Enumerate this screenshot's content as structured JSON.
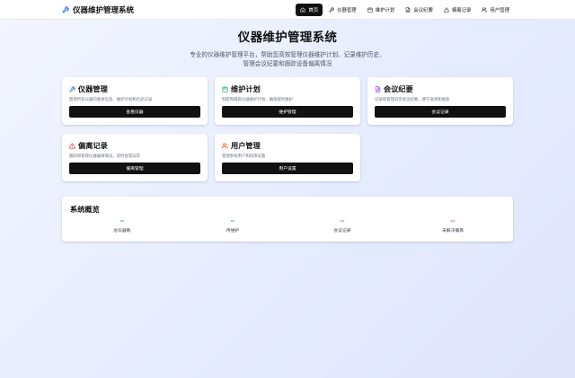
{
  "brand": {
    "title": "仪器维护管理系统",
    "icon": "wrench-icon"
  },
  "nav": [
    {
      "label": "首页",
      "icon": "home-icon",
      "active": true
    },
    {
      "label": "仪器管理",
      "icon": "wrench-icon"
    },
    {
      "label": "维护计划",
      "icon": "calendar-icon"
    },
    {
      "label": "会议纪要",
      "icon": "document-icon"
    },
    {
      "label": "偏离记录",
      "icon": "warning-icon"
    },
    {
      "label": "用户管理",
      "icon": "users-icon"
    }
  ],
  "hero": {
    "title": "仪器维护管理系统",
    "subtitle_line1": "专业的仪器维护管理平台，帮助您高效管理仪器维护计划、记录维护历史、",
    "subtitle_line2": "管理会议纪要和跟踪设备偏离情况"
  },
  "cards": {
    "instruments": {
      "title": "仪器管理",
      "desc": "管理所有仪器的基本信息、维护计划和历史记录",
      "button": "查看仪器",
      "icon": "wrench-icon",
      "color": "#2563eb"
    },
    "plans": {
      "title": "维护计划",
      "desc": "制定和跟踪仪器维护计划，确保按时维护",
      "button": "维护管理",
      "icon": "calendar-icon",
      "color": "#16a34a"
    },
    "minutes": {
      "title": "会议纪要",
      "desc": "记录和管理日常会议纪要，便于查阅和搜索",
      "button": "会议记录",
      "icon": "document-icon",
      "color": "#9333ea"
    },
    "deviations": {
      "title": "偏离记录",
      "desc": "跟踪和管理仪器偏离情况，及时处理异常",
      "button": "偏离管理",
      "icon": "warning-icon",
      "color": "#dc2626"
    },
    "users": {
      "title": "用户管理",
      "desc": "管理系统用户和权限设置",
      "button": "用户设置",
      "icon": "users-icon",
      "color": "#ea580c"
    }
  },
  "overview": {
    "title": "系统概览",
    "stats": [
      {
        "value": "--",
        "label": "总仪器数",
        "color": "#2563eb"
      },
      {
        "value": "--",
        "label": "待维护",
        "color": "#16a34a"
      },
      {
        "value": "--",
        "label": "会议记录",
        "color": "#9333ea"
      },
      {
        "value": "--",
        "label": "未解决偏离",
        "color": "#dc2626"
      }
    ]
  }
}
